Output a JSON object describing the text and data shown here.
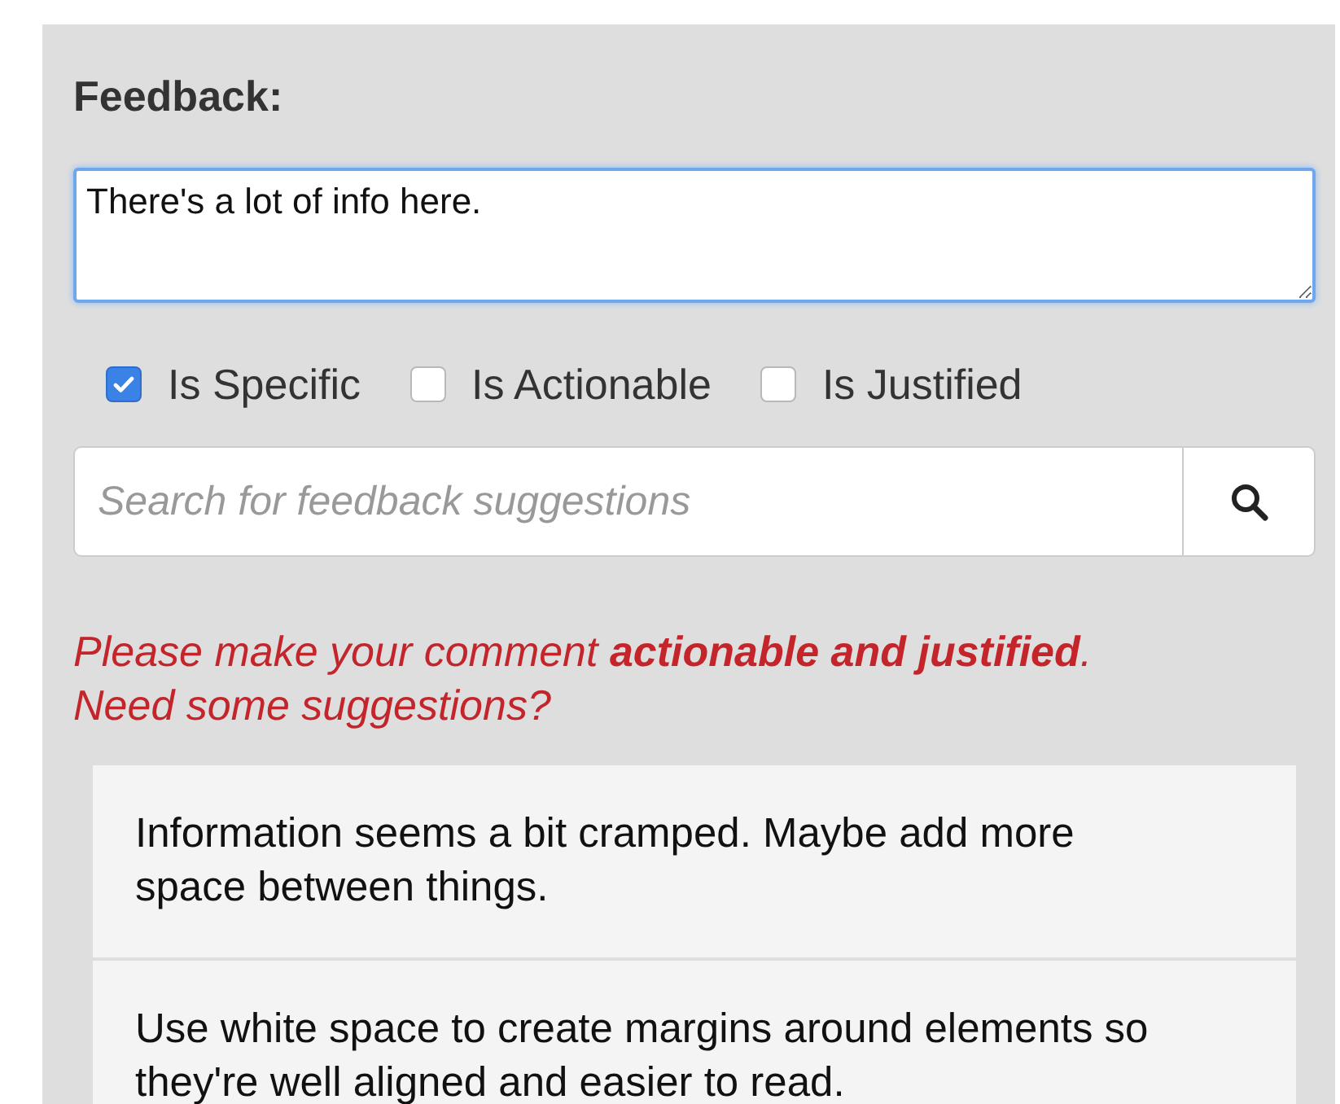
{
  "heading": "Feedback:",
  "comment": {
    "value": "There's a lot of info here."
  },
  "criteria": [
    {
      "label": "Is Specific",
      "checked": true
    },
    {
      "label": "Is Actionable",
      "checked": false
    },
    {
      "label": "Is Justified",
      "checked": false
    }
  ],
  "search": {
    "placeholder": "Search for feedback suggestions"
  },
  "prompt": {
    "message": "Please make your comment **actionable and justified**.",
    "question": "Need some suggestions?"
  },
  "suggestions": [
    "Information seems a bit cramped. Maybe add more space between things.",
    "Use white space to create margins around elements so they're well aligned and easier to read."
  ]
}
